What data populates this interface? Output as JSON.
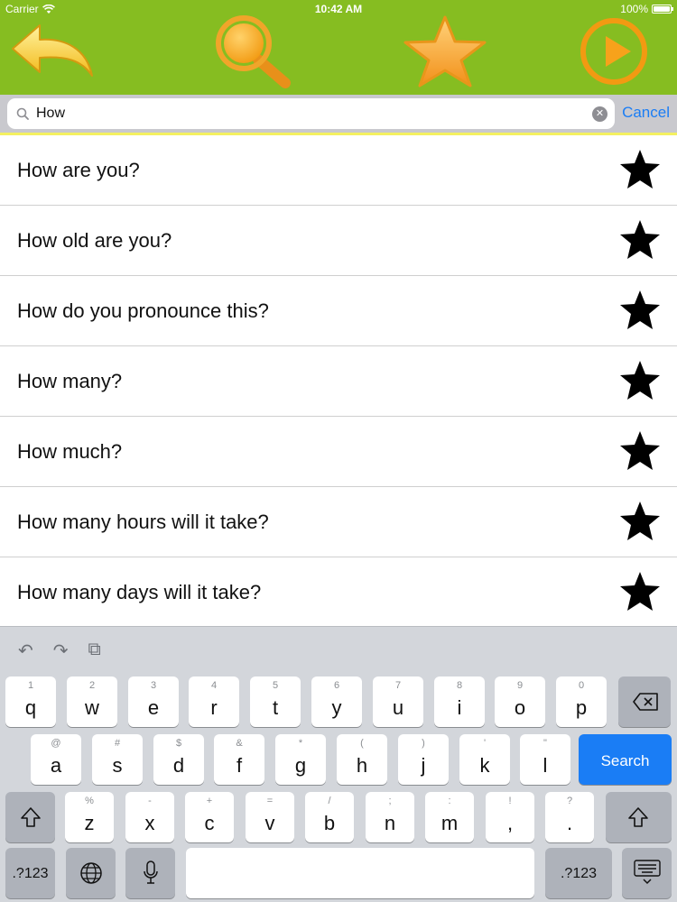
{
  "status_bar": {
    "carrier": "Carrier",
    "time": "10:42 AM",
    "battery": "100%",
    "battery_level": 1.0
  },
  "toolbar": {
    "back_icon": "back-arrow-icon",
    "search_icon": "magnifier-icon",
    "favorites_icon": "star-icon",
    "play_icon": "play-icon",
    "colors": {
      "bar": "#86bd21",
      "icon": "#f7a21b",
      "back": "#f2cc2b"
    }
  },
  "search": {
    "query": "How",
    "cancel_label": "Cancel"
  },
  "results": [
    {
      "text": "How are you?"
    },
    {
      "text": "How old are you?"
    },
    {
      "text": "How do you pronounce this?"
    },
    {
      "text": "How many?"
    },
    {
      "text": "How much?"
    },
    {
      "text": "How many hours will it take?"
    },
    {
      "text": "How many days will it take?"
    }
  ],
  "keyboard": {
    "row1": [
      {
        "hint": "1",
        "key": "q"
      },
      {
        "hint": "2",
        "key": "w"
      },
      {
        "hint": "3",
        "key": "e"
      },
      {
        "hint": "4",
        "key": "r"
      },
      {
        "hint": "5",
        "key": "t"
      },
      {
        "hint": "6",
        "key": "y"
      },
      {
        "hint": "7",
        "key": "u"
      },
      {
        "hint": "8",
        "key": "i"
      },
      {
        "hint": "9",
        "key": "o"
      },
      {
        "hint": "0",
        "key": "p"
      }
    ],
    "row2": [
      {
        "hint": "@",
        "key": "a"
      },
      {
        "hint": "#",
        "key": "s"
      },
      {
        "hint": "$",
        "key": "d"
      },
      {
        "hint": "&",
        "key": "f"
      },
      {
        "hint": "*",
        "key": "g"
      },
      {
        "hint": "(",
        "key": "h"
      },
      {
        "hint": ")",
        "key": "j"
      },
      {
        "hint": "'",
        "key": "k"
      },
      {
        "hint": "\"",
        "key": "l"
      }
    ],
    "row3": [
      {
        "hint": "%",
        "key": "z"
      },
      {
        "hint": "-",
        "key": "x"
      },
      {
        "hint": "+",
        "key": "c"
      },
      {
        "hint": "=",
        "key": "v"
      },
      {
        "hint": "/",
        "key": "b"
      },
      {
        "hint": ";",
        "key": "n"
      },
      {
        "hint": ":",
        "key": "m"
      },
      {
        "hint": "!",
        "key": ","
      },
      {
        "hint": "?",
        "key": "."
      }
    ],
    "search_label": "Search",
    "num_label": ".?123",
    "num_label_right": ".?123"
  }
}
